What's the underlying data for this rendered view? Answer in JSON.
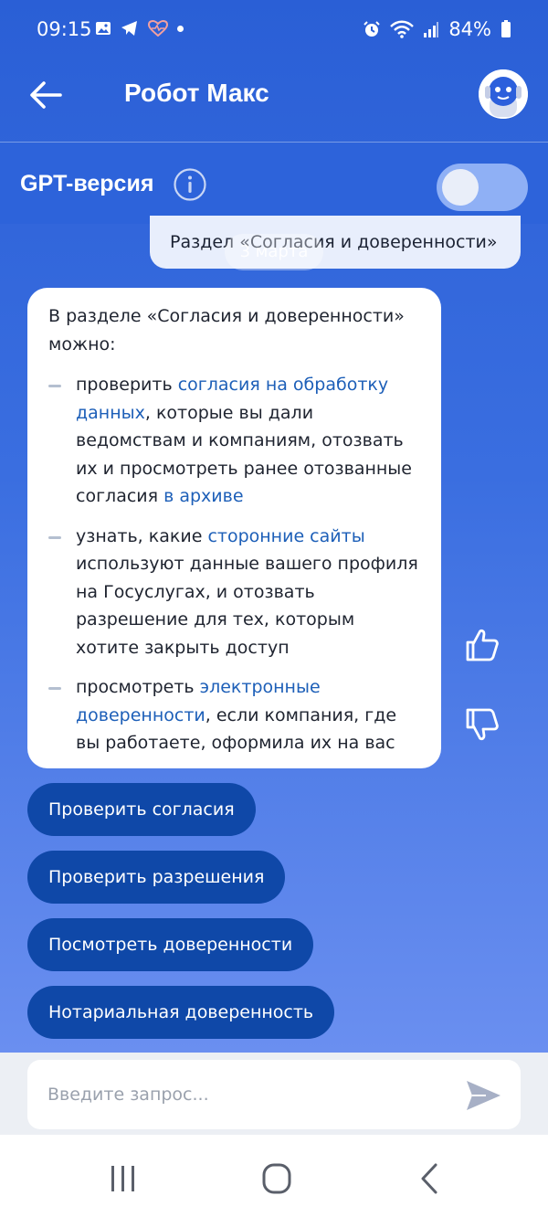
{
  "status_bar": {
    "time": "09:15",
    "battery": "84%",
    "icons_left": [
      "gallery-icon",
      "telegram-icon",
      "heart-pulse-icon",
      "dot-icon"
    ],
    "icons_right": [
      "alarm-icon",
      "wifi-icon",
      "signal-icon",
      "battery-icon"
    ]
  },
  "header": {
    "title": "Робот Макс",
    "back_icon": "arrow-left-icon",
    "avatar_icon": "robot-avatar-icon"
  },
  "gpt": {
    "label": "GPT-версия",
    "info_icon": "info-icon",
    "toggle_on": false
  },
  "chat": {
    "user_message": "Раздел «Согласия и доверенности»",
    "date_label": "3 марта",
    "bot_intro": "В разделе «Согласия и доверенности» можно:",
    "bot_items": [
      {
        "pre": "проверить ",
        "link": "согласия на обработку данных",
        "post": ", которые вы дали ведомствам и компаниям, отозвать их и просмотреть ранее отозванные согласия ",
        "link2": "в архиве"
      },
      {
        "pre": "узнать, какие ",
        "link": "сторонние сайты",
        "post": " используют данные вашего профиля на Госуслугах, и отозвать разрешение для тех, которым хотите закрыть доступ"
      },
      {
        "pre": "просмотреть ",
        "link": "электронные доверенности",
        "post": ", если компания, где вы работаете, оформила их на вас"
      }
    ],
    "like_icon": "thumbs-up-icon",
    "dislike_icon": "thumbs-down-icon",
    "quick_replies": [
      "Проверить согласия",
      "Проверить разрешения",
      "Посмотреть доверенности",
      "Нотариальная доверенность"
    ]
  },
  "input": {
    "placeholder": "Введите запрос...",
    "value": "",
    "send_icon": "send-icon"
  },
  "nav": {
    "icons": [
      "recent-apps-icon",
      "home-icon",
      "back-icon"
    ]
  },
  "colors": {
    "accent": "#2a5fd6",
    "quick_reply": "#0f48a8",
    "link": "#1d5fb8"
  }
}
